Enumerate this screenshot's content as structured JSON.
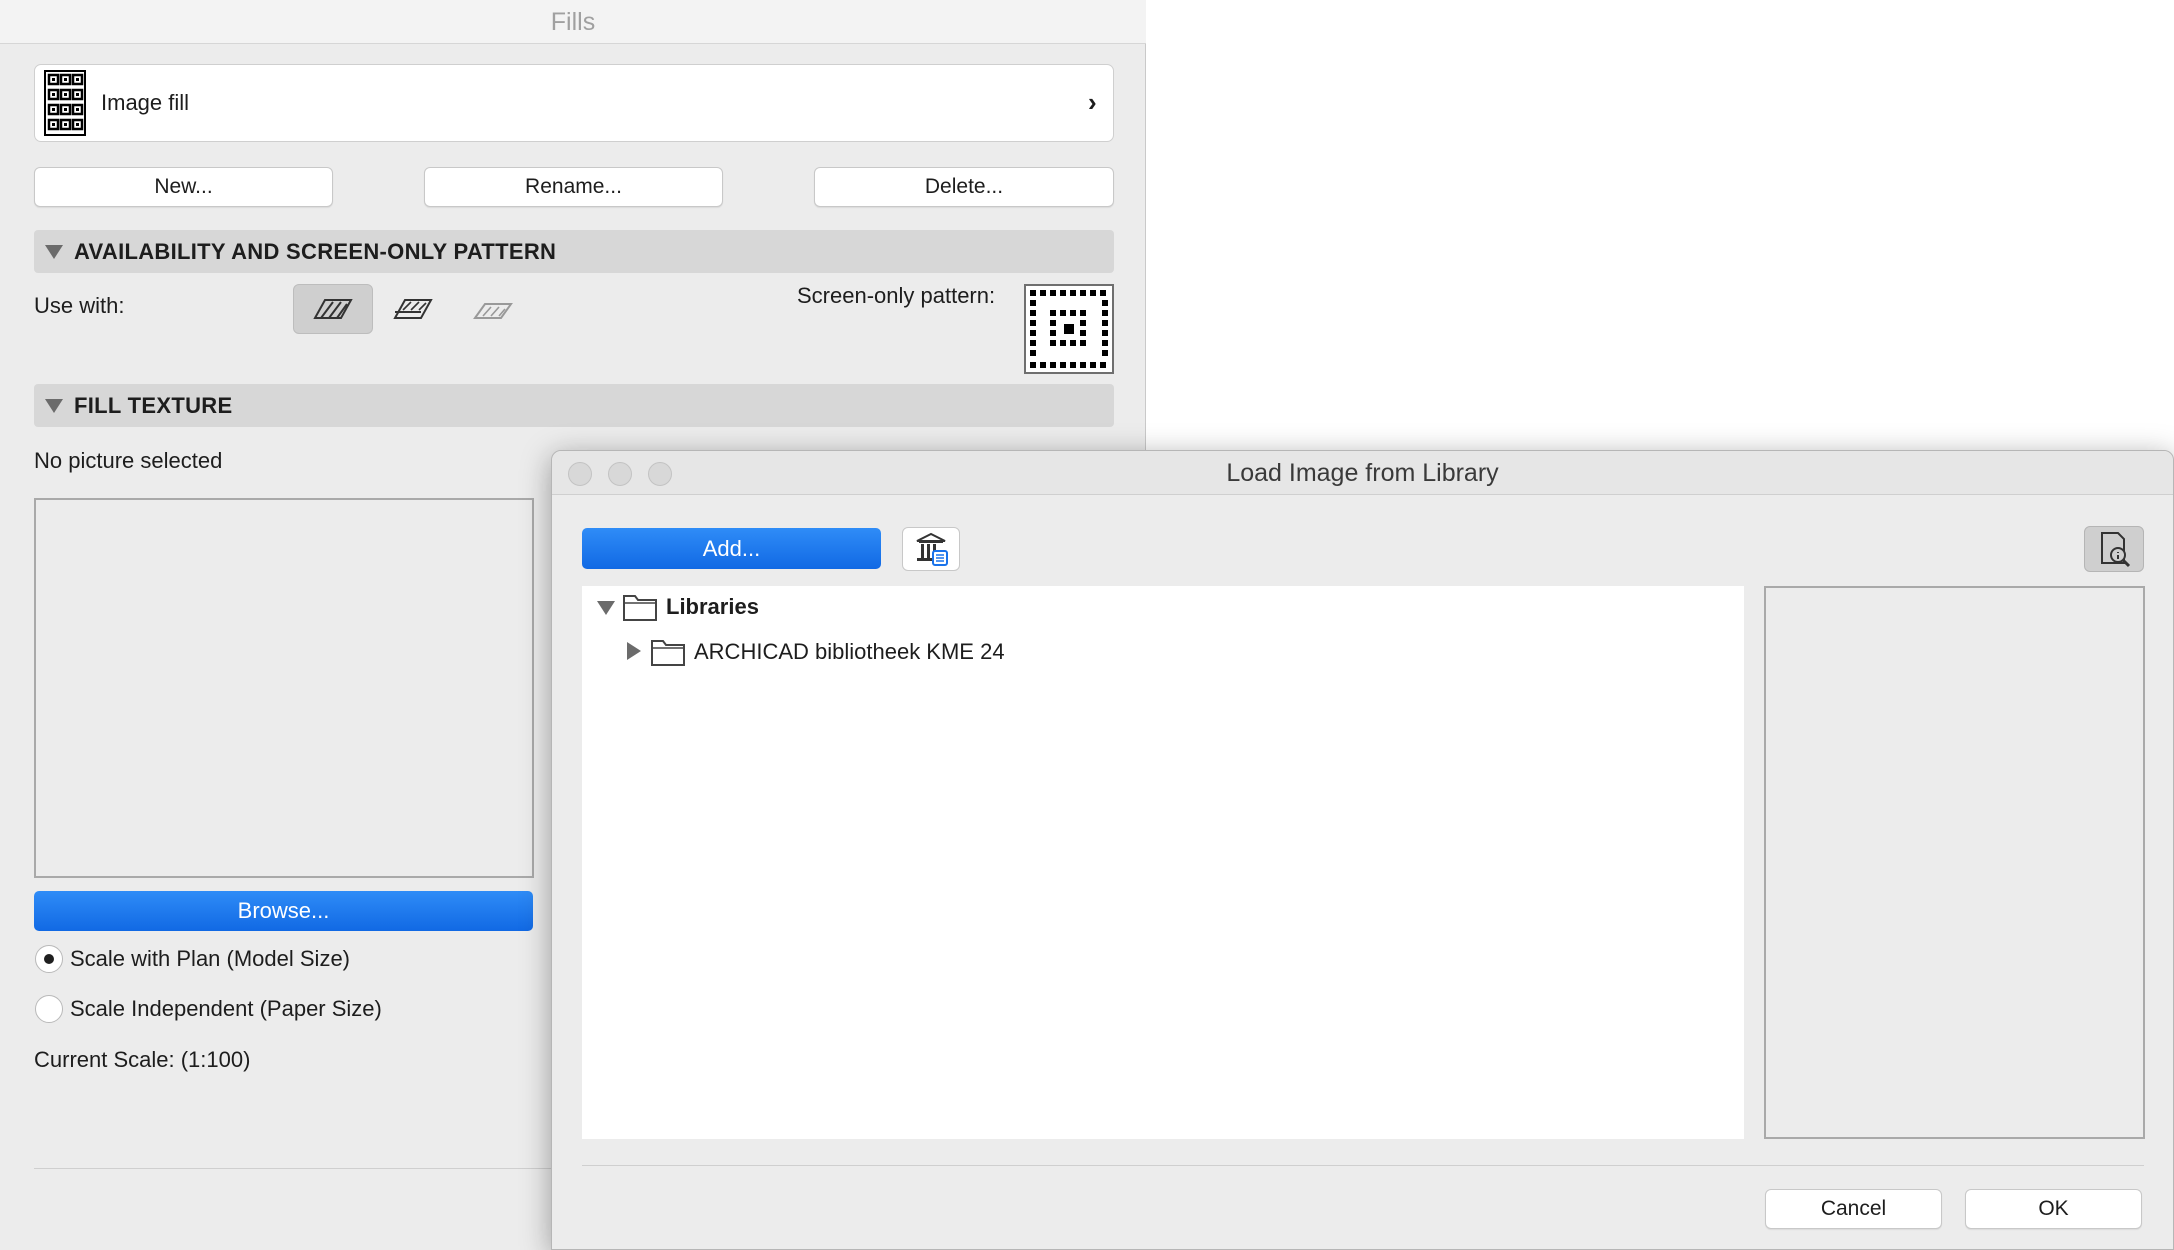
{
  "fills_window": {
    "title": "Fills",
    "fill_selector": {
      "name": "Image fill",
      "chevron": "›",
      "icon": "image-fill-pattern-icon"
    },
    "buttons": {
      "new": "New...",
      "rename": "Rename...",
      "delete": "Delete..."
    },
    "availability_section": {
      "title": "AVAILABILITY AND SCREEN-ONLY PATTERN",
      "use_with_label": "Use with:",
      "use_with_icons": [
        "cut-fill-icon",
        "cover-fill-icon",
        "drafting-fill-icon"
      ],
      "screen_only_label": "Screen-only pattern:"
    },
    "texture_section": {
      "title": "FILL TEXTURE",
      "status": "No picture selected",
      "browse_label": "Browse...",
      "scale_options": [
        {
          "label": "Scale with Plan (Model Size)",
          "selected": true
        },
        {
          "label": "Scale Independent (Paper Size)",
          "selected": false
        }
      ],
      "current_scale": "Current Scale: (1:100)"
    }
  },
  "dialog": {
    "title": "Load Image from Library",
    "add_label": "Add...",
    "tree": [
      {
        "label": "Libraries",
        "expanded": true,
        "bold": true
      },
      {
        "label": "ARCHICAD bibliotheek KME 24",
        "expanded": false,
        "bold": false
      }
    ],
    "cancel_label": "Cancel",
    "ok_label": "OK"
  },
  "colors": {
    "accent": "#1a73eb",
    "window_bg": "#ececec",
    "section_bar": "#d7d7d7"
  }
}
